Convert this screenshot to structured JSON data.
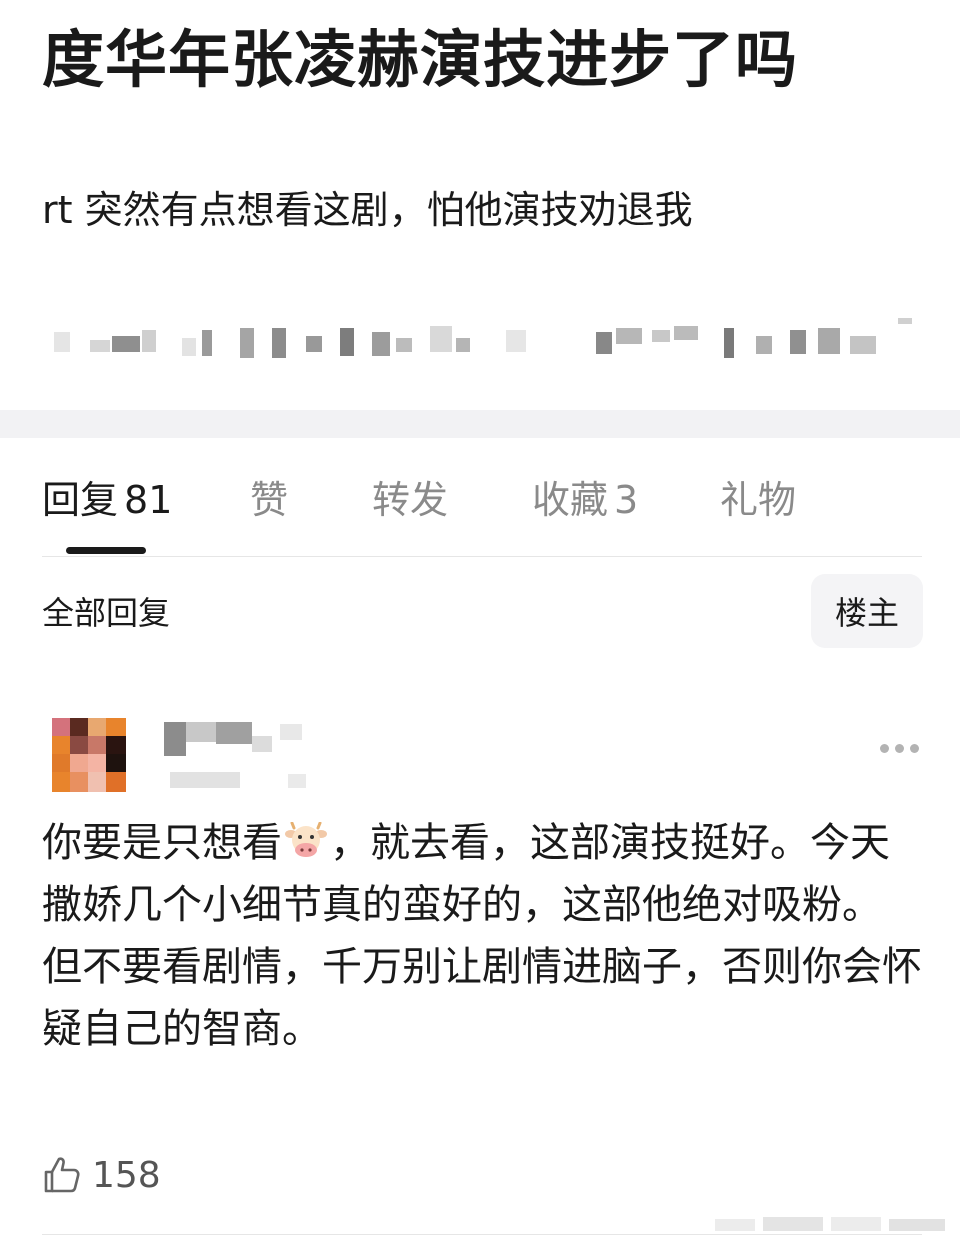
{
  "post": {
    "title": "度华年张凌赫演技进步了吗",
    "body": "rt 突然有点想看这剧，怕他演技劝退我"
  },
  "tabs": [
    {
      "label": "回复",
      "count": "81",
      "active": true
    },
    {
      "label": "赞",
      "count": "",
      "active": false
    },
    {
      "label": "转发",
      "count": "",
      "active": false
    },
    {
      "label": "收藏",
      "count": "3",
      "active": false
    },
    {
      "label": "礼物",
      "count": "",
      "active": false
    }
  ],
  "replies_section": {
    "label": "全部回复",
    "filter_button": "楼主"
  },
  "reply": {
    "line1_before_emoji": "你要是只想看",
    "emoji": "cow-face-icon",
    "line1_after_emoji": "，就去看，这部演技挺好。今天撒娇几个小细节真的蛮好的，这部他绝对吸粉。",
    "line2": "但不要看剧情，千万别让剧情进脑子，否则你会怀疑自己的智商。",
    "likes": "158"
  },
  "colors": {
    "text": "#1a1a1a",
    "muted": "#8a8a8a",
    "band": "#f2f2f4",
    "button_bg": "#f4f4f6"
  }
}
